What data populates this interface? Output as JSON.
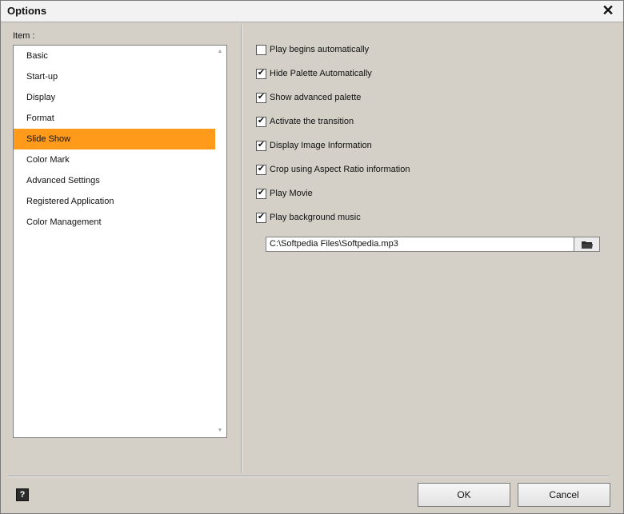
{
  "window": {
    "title": "Options"
  },
  "icons": {
    "close": "close-icon",
    "help": "help-icon",
    "folder": "folder-icon"
  },
  "list": {
    "label": "Item :",
    "selected_index": 4,
    "items": [
      {
        "label": "Basic"
      },
      {
        "label": "Start-up"
      },
      {
        "label": "Display"
      },
      {
        "label": "Format"
      },
      {
        "label": "Slide Show"
      },
      {
        "label": "Color Mark"
      },
      {
        "label": "Advanced Settings"
      },
      {
        "label": "Registered Application"
      },
      {
        "label": "Color Management"
      }
    ]
  },
  "options": [
    {
      "label": "Play begins automatically",
      "checked": false
    },
    {
      "label": "Hide Palette Automatically",
      "checked": true
    },
    {
      "label": "Show advanced palette",
      "checked": true
    },
    {
      "label": "Activate the transition",
      "checked": true
    },
    {
      "label": "Display Image Information",
      "checked": true
    },
    {
      "label": "Crop using Aspect Ratio information",
      "checked": true
    },
    {
      "label": "Play Movie",
      "checked": true
    },
    {
      "label": "Play background music",
      "checked": true
    }
  ],
  "music_path": {
    "value": "C:\\Softpedia Files\\Softpedia.mp3"
  },
  "footer": {
    "help_label": "?",
    "ok_label": "OK",
    "cancel_label": "Cancel"
  },
  "colors": {
    "selection": "#ff9a1a",
    "background": "#d4d0c8"
  }
}
